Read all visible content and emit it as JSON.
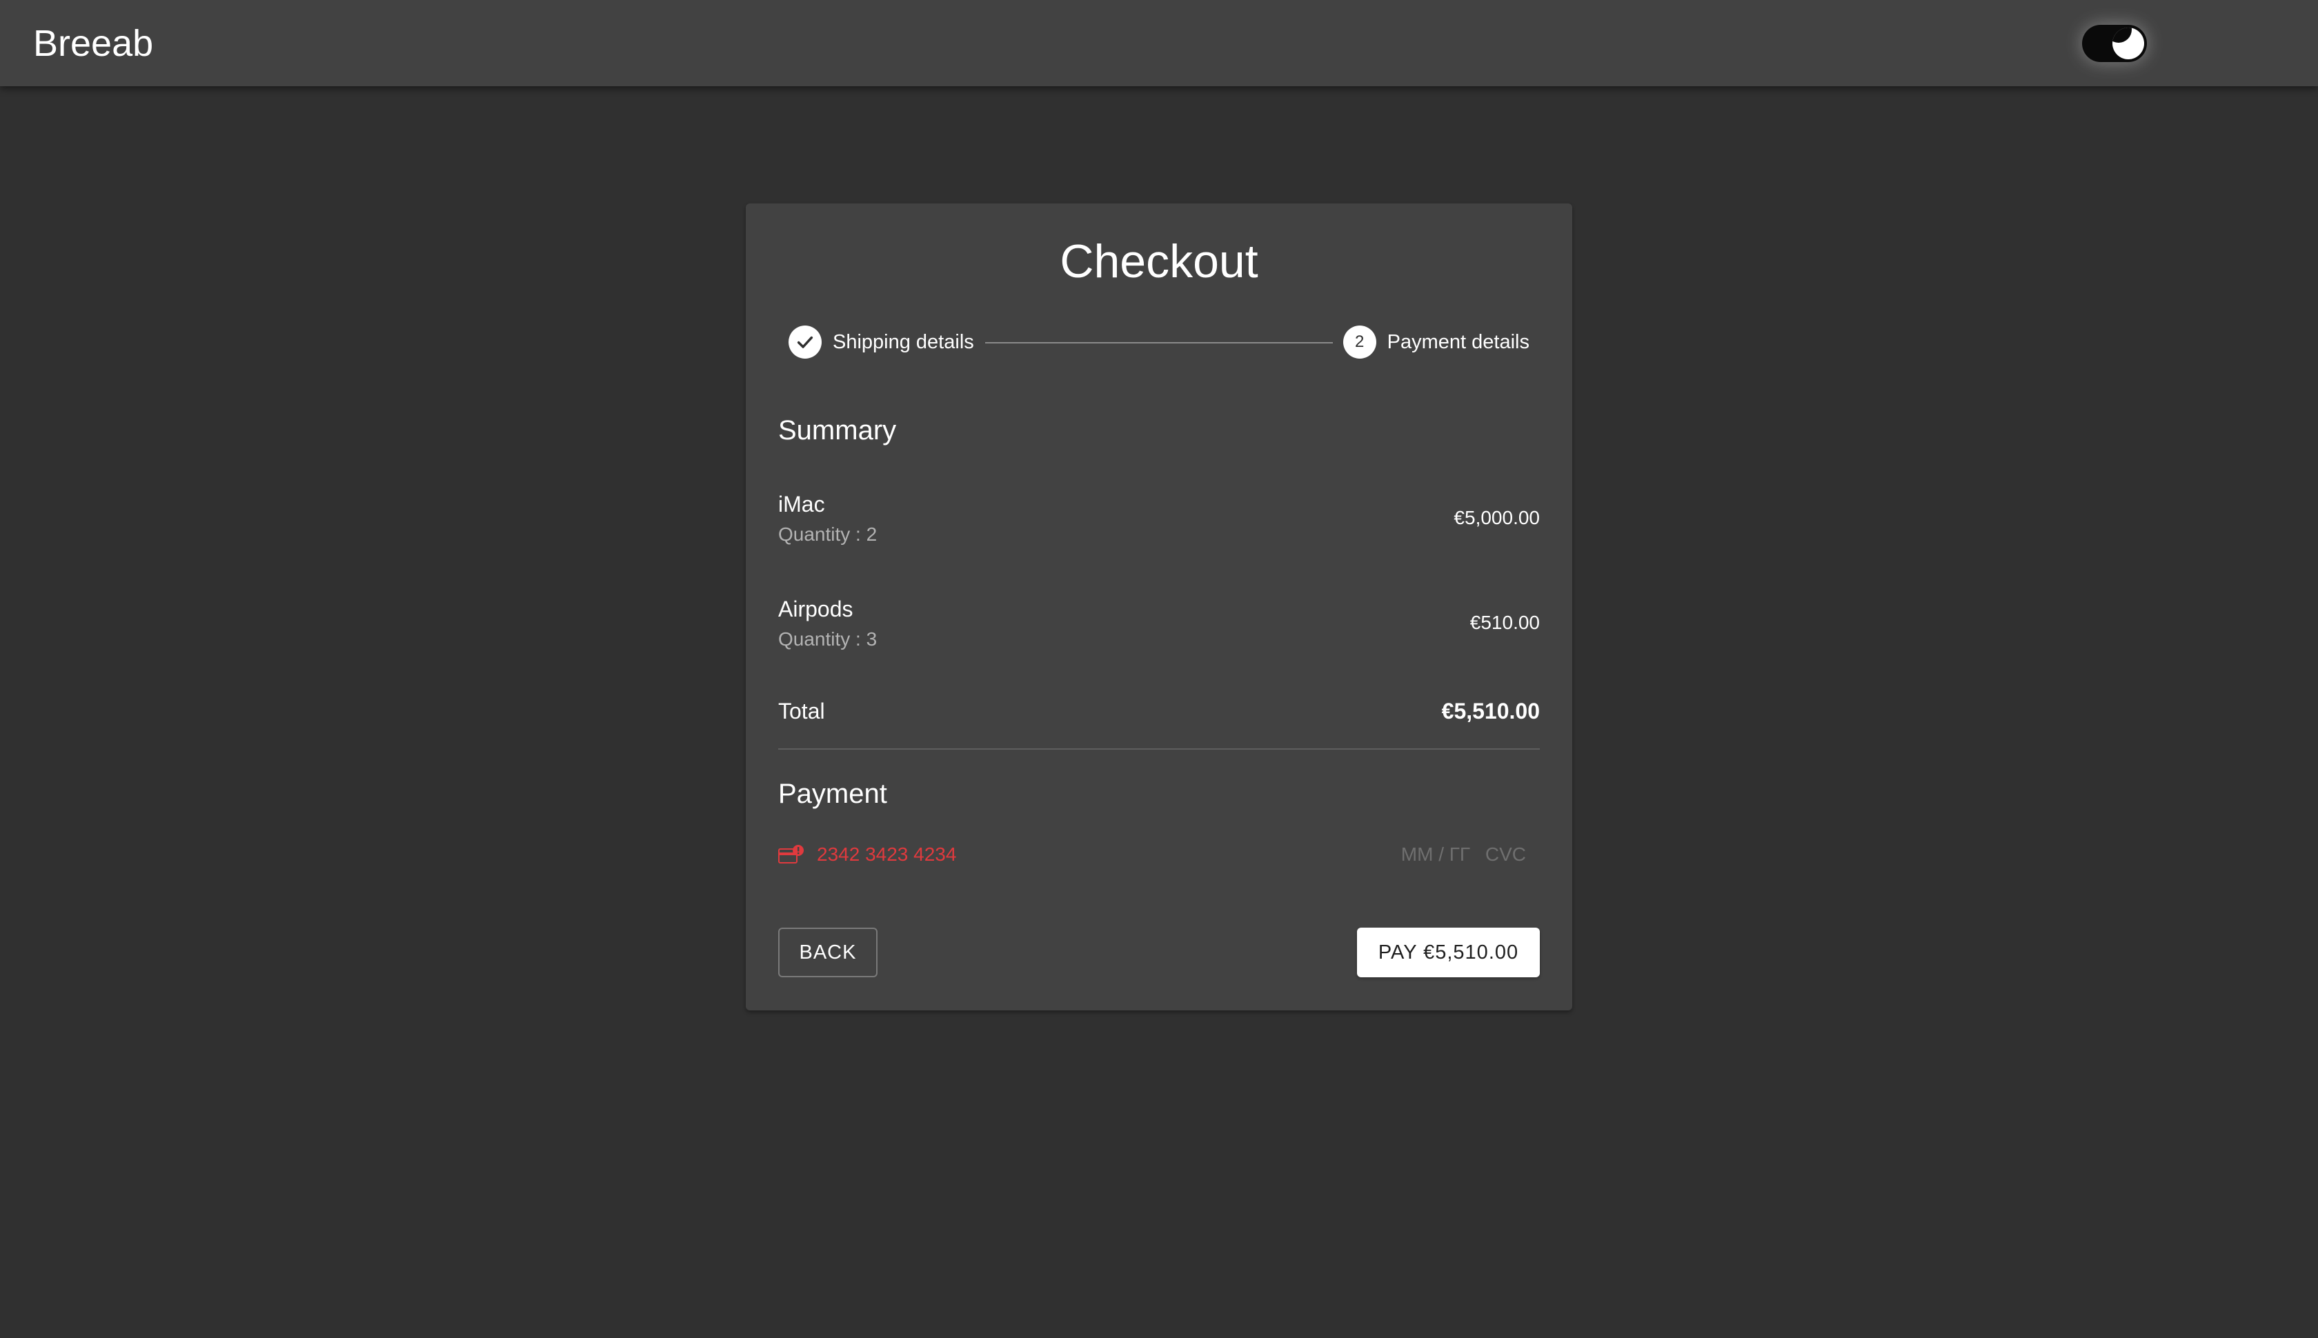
{
  "header": {
    "brand": "Breeab",
    "theme_toggle_icon": "dark-mode-toggle-icon"
  },
  "checkout": {
    "title": "Checkout",
    "steps": [
      {
        "label": "Shipping details",
        "status": "completed",
        "icon": "check-icon"
      },
      {
        "label": "Payment details",
        "status": "active",
        "number": "2"
      }
    ],
    "summary": {
      "title": "Summary",
      "items": [
        {
          "name": "iMac",
          "quantity": "Quantity : 2",
          "price": "€5,000.00"
        },
        {
          "name": "Airpods",
          "quantity": "Quantity : 3",
          "price": "€510.00"
        }
      ],
      "total_label": "Total",
      "total_value": "€5,510.00"
    },
    "payment": {
      "title": "Payment",
      "card_icon": "card-error-icon",
      "card_number": "2342 3423 4234",
      "expiry_placeholder": "MM / ГГ",
      "cvc_placeholder": "CVC",
      "error_color": "#e03a3e"
    },
    "buttons": {
      "back": "BACK",
      "pay": "PAY €5,510.00"
    }
  }
}
